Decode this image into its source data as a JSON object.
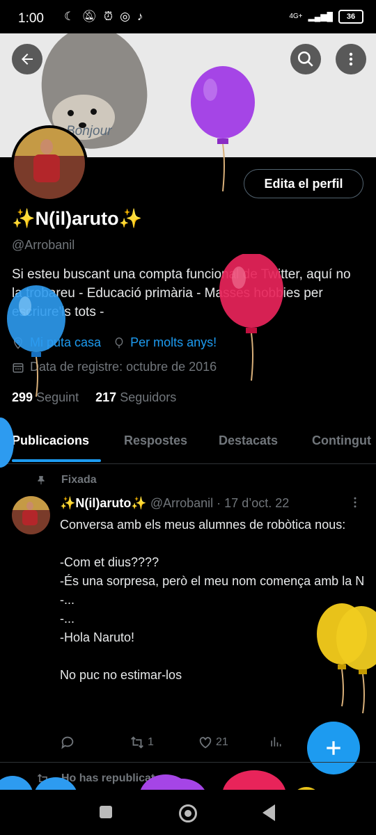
{
  "status": {
    "time": "1:00",
    "network": "4G+",
    "battery": "36"
  },
  "header": {
    "banner_text": "Bonjour",
    "back_icon": "arrow-left-icon",
    "search_icon": "search-icon",
    "more_icon": "more-vertical-icon"
  },
  "profile": {
    "edit_label": "Edita el perfil",
    "display_name": "✨N(il)aruto✨",
    "handle": "@Arrobanil",
    "bio": "Si esteu buscant una compta funcional de Twitter, aquí no la trobareu  - Educació primària - Masses hobbies per escriure'ls tots -",
    "location": "Mi puta casa",
    "birthday": "Per molts anys!",
    "joined": "Data de registre: octubre de 2016",
    "following_count": "299",
    "following_label": "Seguint",
    "followers_count": "217",
    "followers_label": "Seguidors"
  },
  "tabs": [
    {
      "label": "Publicacions",
      "active": true
    },
    {
      "label": "Respostes"
    },
    {
      "label": "Destacats"
    },
    {
      "label": "Contingut"
    }
  ],
  "pinned_tweet": {
    "pinned_label": "Fixada",
    "author_name": "✨N(il)aruto✨",
    "author_handle": "@Arrobanil",
    "date": "· 17 d’oct. 22",
    "text": "Conversa amb els meus alumnes de robòtica nous:\n\n-Com et dius????\n-És una sorpresa, però el meu nom comença amb la N\n-...\n-...\n-Hola Naruto!\n\nNo puc no estimar-los",
    "retweets": "1",
    "likes": "21"
  },
  "next_item": {
    "reposted_label": "Ho has republicat"
  },
  "colors": {
    "accent": "#1d9bf0",
    "background": "#000000",
    "muted": "#71767b"
  }
}
